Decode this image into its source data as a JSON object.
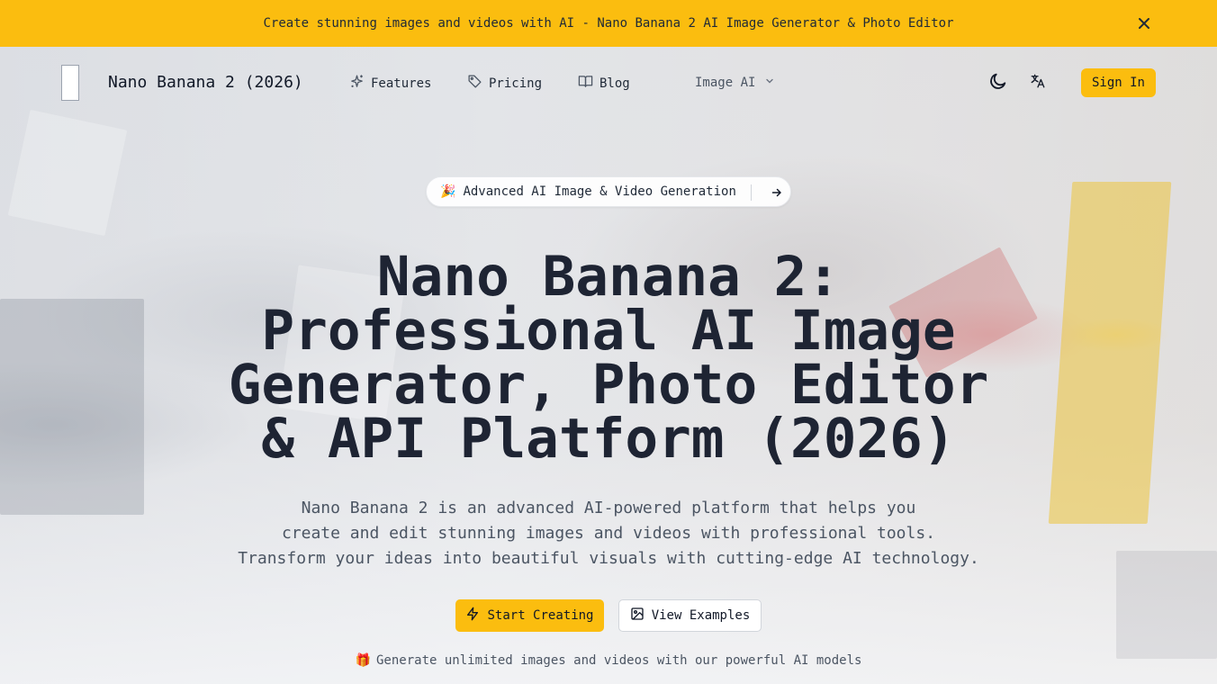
{
  "banner": {
    "text": "Create stunning images and videos with AI - Nano Banana 2 AI Image Generator & Photo Editor",
    "close_icon": "close-icon"
  },
  "header": {
    "brand": "Nano Banana 2 (2026)",
    "nav": [
      {
        "label": "Features",
        "icon": "sparkles-icon"
      },
      {
        "label": "Pricing",
        "icon": "tag-icon"
      },
      {
        "label": "Blog",
        "icon": "book-open-icon"
      }
    ],
    "model_select": {
      "value": "Image AI"
    },
    "theme_toggle_icon": "moon-icon",
    "language_icon": "translate-icon",
    "signin_label": "Sign In"
  },
  "hero": {
    "pill": {
      "emoji": "🎉",
      "text": "Advanced AI Image & Video Generation",
      "icon": "arrow-right-icon"
    },
    "title_lines": [
      "Nano Banana 2:",
      "Professional AI Image",
      "Generator, Photo Editor",
      "& API Platform (2026)"
    ],
    "description_lines": [
      "Nano Banana 2 is an advanced AI-powered platform that helps you",
      "create and edit stunning images and videos with professional tools.",
      "Transform your ideas into beautiful visuals with cutting-edge AI technology."
    ],
    "primary_button": "Start Creating",
    "secondary_button": "View Examples",
    "footnote_emoji": "🎁",
    "footnote": "Generate unlimited images and videos with our powerful AI models"
  },
  "colors": {
    "accent": "#fbbd0f",
    "title": "#1e2433",
    "muted_text": "#4b5563"
  }
}
